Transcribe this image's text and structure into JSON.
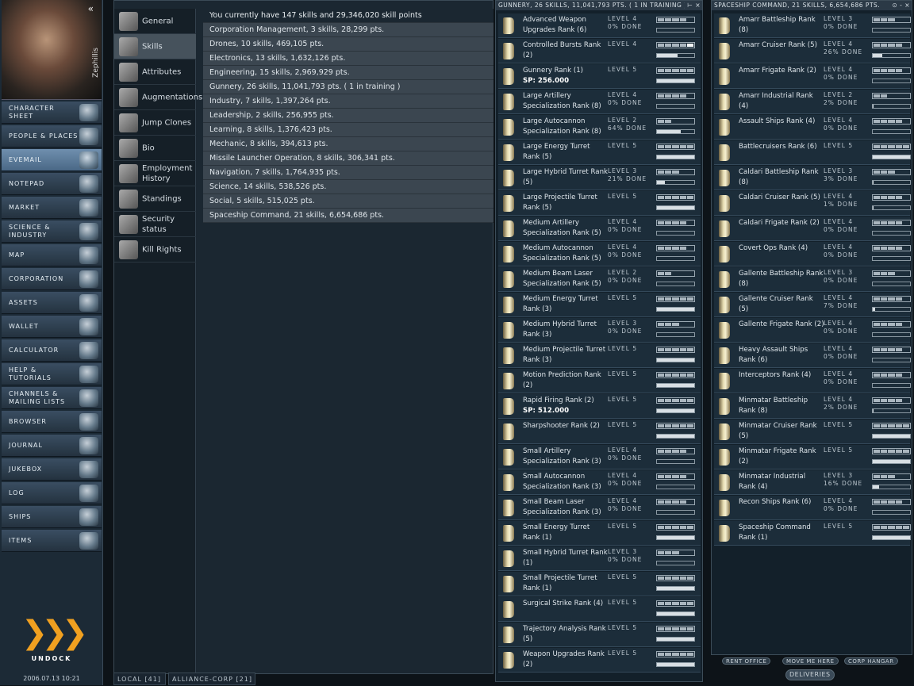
{
  "neocom": {
    "character_name": "Zephillis",
    "collapse_glyph": "«",
    "items": [
      {
        "label": "CHARACTER SHEET",
        "icon": "character-sheet-icon"
      },
      {
        "label": "PEOPLE & PLACES",
        "icon": "people-places-icon"
      },
      {
        "label": "EVEMAIL",
        "icon": "evemail-icon",
        "selected": true
      },
      {
        "label": "NOTEPAD",
        "icon": "notepad-icon"
      },
      {
        "label": "MARKET",
        "icon": "market-icon"
      },
      {
        "label": "SCIENCE & INDUSTRY",
        "icon": "science-industry-icon"
      },
      {
        "label": "MAP",
        "icon": "map-icon"
      },
      {
        "label": "CORPORATION",
        "icon": "corporation-icon"
      },
      {
        "label": "ASSETS",
        "icon": "assets-icon"
      },
      {
        "label": "WALLET",
        "icon": "wallet-icon"
      },
      {
        "label": "CALCULATOR",
        "icon": "calculator-icon"
      },
      {
        "label": "HELP & TUTORIALS",
        "icon": "help-icon"
      },
      {
        "label": "CHANNELS & MAILING LISTS",
        "icon": "channels-icon"
      },
      {
        "label": "BROWSER",
        "icon": "browser-icon"
      },
      {
        "label": "JOURNAL",
        "icon": "journal-icon"
      },
      {
        "label": "JUKEBOX",
        "icon": "jukebox-icon"
      },
      {
        "label": "LOG",
        "icon": "log-icon"
      },
      {
        "label": "SHIPS",
        "icon": "ships-icon"
      },
      {
        "label": "ITEMS",
        "icon": "items-icon"
      }
    ],
    "undock_glyph": "❯❯❯",
    "undock_label": "UNDOCK",
    "clock": "2006.07.13 10:21"
  },
  "character_sheet": {
    "tabs": [
      {
        "label": "General",
        "icon": "general-icon"
      },
      {
        "label": "Skills",
        "icon": "skills-icon",
        "selected": true
      },
      {
        "label": "Attributes",
        "icon": "attributes-icon"
      },
      {
        "label": "Augmentations",
        "icon": "augmentations-icon"
      },
      {
        "label": "Jump Clones",
        "icon": "jump-clones-icon"
      },
      {
        "label": "Bio",
        "icon": "bio-icon"
      },
      {
        "label": "Employment History",
        "icon": "employment-history-icon"
      },
      {
        "label": "Standings",
        "icon": "standings-icon"
      },
      {
        "label": "Security status",
        "icon": "security-status-icon"
      },
      {
        "label": "Kill Rights",
        "icon": "kill-rights-icon"
      }
    ],
    "summary": "You currently have 147 skills and 29,346,020 skill points",
    "groups": [
      "Corporation Management, 3 skills, 28,299 pts.",
      "Drones, 10 skills, 469,105 pts.",
      "Electronics, 13 skills, 1,632,126 pts.",
      "Engineering, 15 skills, 2,969,929 pts.",
      "Gunnery, 26 skills, 11,041,793 pts. ( 1 in training )",
      "Industry, 7 skills, 1,397,264 pts.",
      "Leadership, 2 skills, 256,955 pts.",
      "Learning, 8 skills, 1,376,423 pts.",
      "Mechanic, 8 skills, 394,613 pts.",
      "Missile Launcher Operation, 8 skills, 306,341 pts.",
      "Navigation, 7 skills, 1,764,935 pts.",
      "Science, 14 skills, 538,526 pts.",
      "Social, 5 skills, 515,025 pts.",
      "Spaceship Command, 21 skills, 6,654,686 pts."
    ]
  },
  "bottom_tabs": [
    "LOCAL [41]",
    "ALLIANCE-CORP [21]"
  ],
  "gunnery_window": {
    "title": "GUNNERY, 26 SKILLS, 11,041,793 PTS. ( 1 IN TRAINING )",
    "controls": "⊢ ×",
    "skills": [
      {
        "name": "Advanced Weapon Upgrades Rank (6)",
        "level_text": "LEVEL 4",
        "done_text": "0% DONE",
        "level": 4,
        "progress": 0
      },
      {
        "name": "Controlled Bursts Rank (2)",
        "level_text": "LEVEL 4",
        "done_text": "",
        "level": 4,
        "training": true,
        "progress": 0.55
      },
      {
        "name": "Gunnery Rank (1)",
        "sp": "SP: 256.000",
        "level_text": "LEVEL 5",
        "done_text": "",
        "level": 5,
        "progress": 1
      },
      {
        "name": "Large Artillery Specialization Rank (8)",
        "level_text": "LEVEL 4",
        "done_text": "0% DONE",
        "level": 4,
        "progress": 0
      },
      {
        "name": "Large Autocannon Specialization Rank (8)",
        "level_text": "LEVEL 2",
        "done_text": "64% DONE",
        "level": 2,
        "progress": 0.64
      },
      {
        "name": "Large Energy Turret Rank (5)",
        "level_text": "LEVEL 5",
        "done_text": "",
        "level": 5,
        "progress": 1
      },
      {
        "name": "Large Hybrid Turret Rank (5)",
        "level_text": "LEVEL 3",
        "done_text": "21% DONE",
        "level": 3,
        "progress": 0.21
      },
      {
        "name": "Large Projectile Turret Rank (5)",
        "level_text": "LEVEL 5",
        "done_text": "",
        "level": 5,
        "progress": 1
      },
      {
        "name": "Medium Artillery Specialization Rank (5)",
        "level_text": "LEVEL 4",
        "done_text": "0% DONE",
        "level": 4,
        "progress": 0
      },
      {
        "name": "Medium Autocannon Specialization Rank (5)",
        "level_text": "LEVEL 4",
        "done_text": "0% DONE",
        "level": 4,
        "progress": 0
      },
      {
        "name": "Medium Beam Laser Specialization Rank (5)",
        "level_text": "LEVEL 2",
        "done_text": "0% DONE",
        "level": 2,
        "progress": 0
      },
      {
        "name": "Medium Energy Turret Rank (3)",
        "level_text": "LEVEL 5",
        "done_text": "",
        "level": 5,
        "progress": 1
      },
      {
        "name": "Medium Hybrid Turret Rank (3)",
        "level_text": "LEVEL 3",
        "done_text": "0% DONE",
        "level": 3,
        "progress": 0
      },
      {
        "name": "Medium Projectile Turret Rank (3)",
        "level_text": "LEVEL 5",
        "done_text": "",
        "level": 5,
        "progress": 1
      },
      {
        "name": "Motion Prediction Rank (2)",
        "level_text": "LEVEL 5",
        "done_text": "",
        "level": 5,
        "progress": 1
      },
      {
        "name": "Rapid Firing Rank (2)",
        "sp": "SP: 512.000",
        "level_text": "LEVEL 5",
        "done_text": "",
        "level": 5,
        "progress": 1
      },
      {
        "name": "Sharpshooter Rank (2)",
        "level_text": "LEVEL 5",
        "done_text": "",
        "level": 5,
        "progress": 1
      },
      {
        "name": "Small Artillery Specialization Rank (3)",
        "level_text": "LEVEL 4",
        "done_text": "0% DONE",
        "level": 4,
        "progress": 0
      },
      {
        "name": "Small Autocannon Specialization Rank (3)",
        "level_text": "LEVEL 4",
        "done_text": "0% DONE",
        "level": 4,
        "progress": 0
      },
      {
        "name": "Small Beam Laser Specialization Rank (3)",
        "level_text": "LEVEL 4",
        "done_text": "0% DONE",
        "level": 4,
        "progress": 0
      },
      {
        "name": "Small Energy Turret Rank (1)",
        "level_text": "LEVEL 5",
        "done_text": "",
        "level": 5,
        "progress": 1
      },
      {
        "name": "Small Hybrid Turret Rank (1)",
        "level_text": "LEVEL 3",
        "done_text": "0% DONE",
        "level": 3,
        "progress": 0
      },
      {
        "name": "Small Projectile Turret Rank (1)",
        "level_text": "LEVEL 5",
        "done_text": "",
        "level": 5,
        "progress": 1
      },
      {
        "name": "Surgical Strike Rank (4)",
        "level_text": "LEVEL 5",
        "done_text": "",
        "level": 5,
        "progress": 1
      },
      {
        "name": "Trajectory Analysis Rank (5)",
        "level_text": "LEVEL 5",
        "done_text": "",
        "level": 5,
        "progress": 1
      },
      {
        "name": "Weapon Upgrades Rank (2)",
        "level_text": "LEVEL 5",
        "done_text": "",
        "level": 5,
        "progress": 1
      }
    ]
  },
  "spaceship_window": {
    "title": "SPACESHIP COMMAND, 21 SKILLS, 6,654,686 PTS.",
    "controls": "⊙ - ×",
    "skills": [
      {
        "name": "Amarr Battleship Rank (8)",
        "level_text": "LEVEL 3",
        "done_text": "0% DONE",
        "level": 3,
        "progress": 0
      },
      {
        "name": "Amarr Cruiser Rank (5)",
        "level_text": "LEVEL 4",
        "done_text": "26% DONE",
        "level": 4,
        "progress": 0.26
      },
      {
        "name": "Amarr Frigate Rank (2)",
        "level_text": "LEVEL 4",
        "done_text": "0% DONE",
        "level": 4,
        "progress": 0
      },
      {
        "name": "Amarr Industrial Rank (4)",
        "level_text": "LEVEL 2",
        "done_text": "2% DONE",
        "level": 2,
        "progress": 0.02
      },
      {
        "name": "Assault Ships Rank (4)",
        "level_text": "LEVEL 4",
        "done_text": "0% DONE",
        "level": 4,
        "progress": 0
      },
      {
        "name": "Battlecruisers Rank (6)",
        "level_text": "LEVEL 5",
        "done_text": "",
        "level": 5,
        "progress": 1
      },
      {
        "name": "Caldari Battleship Rank (8)",
        "level_text": "LEVEL 3",
        "done_text": "3% DONE",
        "level": 3,
        "progress": 0.03
      },
      {
        "name": "Caldari Cruiser Rank (5)",
        "level_text": "LEVEL 4",
        "done_text": "1% DONE",
        "level": 4,
        "progress": 0.01
      },
      {
        "name": "Caldari Frigate Rank (2)",
        "level_text": "LEVEL 4",
        "done_text": "0% DONE",
        "level": 4,
        "progress": 0
      },
      {
        "name": "Covert Ops Rank (4)",
        "level_text": "LEVEL 4",
        "done_text": "0% DONE",
        "level": 4,
        "progress": 0
      },
      {
        "name": "Gallente Battleship Rank (8)",
        "level_text": "LEVEL 3",
        "done_text": "0% DONE",
        "level": 3,
        "progress": 0
      },
      {
        "name": "Gallente Cruiser Rank (5)",
        "level_text": "LEVEL 4",
        "done_text": "7% DONE",
        "level": 4,
        "progress": 0.07
      },
      {
        "name": "Gallente Frigate Rank (2)",
        "level_text": "LEVEL 4",
        "done_text": "0% DONE",
        "level": 4,
        "progress": 0
      },
      {
        "name": "Heavy Assault Ships Rank (6)",
        "level_text": "LEVEL 4",
        "done_text": "0% DONE",
        "level": 4,
        "progress": 0
      },
      {
        "name": "Interceptors Rank (4)",
        "level_text": "LEVEL 4",
        "done_text": "0% DONE",
        "level": 4,
        "progress": 0
      },
      {
        "name": "Minmatar Battleship Rank (8)",
        "level_text": "LEVEL 4",
        "done_text": "2% DONE",
        "level": 4,
        "progress": 0.02
      },
      {
        "name": "Minmatar Cruiser Rank (5)",
        "level_text": "LEVEL 5",
        "done_text": "",
        "level": 5,
        "progress": 1
      },
      {
        "name": "Minmatar Frigate Rank (2)",
        "level_text": "LEVEL 5",
        "done_text": "",
        "level": 5,
        "progress": 1
      },
      {
        "name": "Minmatar Industrial Rank (4)",
        "level_text": "LEVEL 3",
        "done_text": "16% DONE",
        "level": 3,
        "progress": 0.16
      },
      {
        "name": "Recon Ships Rank (6)",
        "level_text": "LEVEL 4",
        "done_text": "0% DONE",
        "level": 4,
        "progress": 0
      },
      {
        "name": "Spaceship Command Rank (1)",
        "level_text": "LEVEL 5",
        "done_text": "",
        "level": 5,
        "progress": 1
      }
    ]
  },
  "depot_buttons": [
    "RENT OFFICE",
    "MOVE ME HERE",
    "CORP HANGAR"
  ],
  "deliveries_label": "DELIVERIES"
}
